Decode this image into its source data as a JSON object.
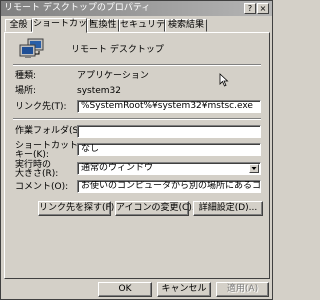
{
  "window": {
    "title": "リモート デスクトップのプロパティ"
  },
  "tabs": [
    {
      "label": "全般"
    },
    {
      "label": "ショートカット"
    },
    {
      "label": "互換性"
    },
    {
      "label": "セキュリティ"
    },
    {
      "label": "検索結果"
    }
  ],
  "header": {
    "name": "リモート デスクトップ"
  },
  "info": {
    "type_label": "種類:",
    "type_value": "アプリケーション",
    "location_label": "場所:",
    "location_value": "system32"
  },
  "fields": {
    "target_label": "リンク先(T):",
    "target_value": "%SystemRoot%¥system32¥mstsc.exe",
    "workdir_label": "作業フォルダ(S):",
    "workdir_value": "",
    "shortcut_label_line1": "ショートカット",
    "shortcut_label_line2": "キー(K):",
    "shortcut_value": "なし",
    "run_label_line1": "実行時の",
    "run_label_line2": "大きさ(R):",
    "run_value": "通常のウィンドウ",
    "comment_label": "コメント(O):",
    "comment_value": "お使いのコンピュータから別の場所にあるコンピュータに接続し"
  },
  "panel_buttons": {
    "find_target": "リンク先を探す(F)...",
    "change_icon": "アイコンの変更(C)...",
    "advanced": "詳細設定(D)..."
  },
  "dialog_buttons": {
    "ok": "OK",
    "cancel": "キャンセル",
    "apply": "適用(A)"
  }
}
